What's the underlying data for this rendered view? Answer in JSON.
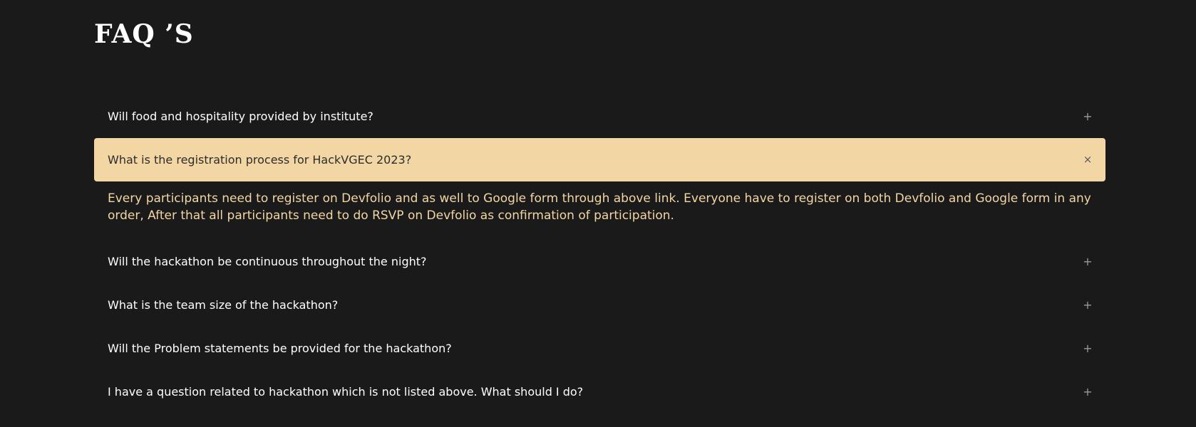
{
  "header": {
    "title": "FAQ ’S"
  },
  "faqs": [
    {
      "question": "Will food and hospitality provided by institute?",
      "toggle": "+",
      "open": false,
      "answer": ""
    },
    {
      "question": "What is the registration process for HackVGEC 2023?",
      "toggle": "×",
      "open": true,
      "answer": "Every participants need to register on Devfolio and as well to Google form through above link. Everyone have to register on both Devfolio and Google form in any order, After that all participants need to do RSVP on Devfolio as confirmation of participation."
    },
    {
      "question": "Will the hackathon be continuous throughout the night?",
      "toggle": "+",
      "open": false,
      "answer": ""
    },
    {
      "question": "What is the team size of the hackathon?",
      "toggle": "+",
      "open": false,
      "answer": ""
    },
    {
      "question": "Will the Problem statements be provided for the hackathon?",
      "toggle": "+",
      "open": false,
      "answer": ""
    },
    {
      "question": "I have a question related to hackathon which is not listed above. What should I do?",
      "toggle": "+",
      "open": false,
      "answer": ""
    }
  ],
  "colors": {
    "background": "#1a1a1a",
    "accent": "#f2d6a4",
    "text": "#ffffff"
  },
  "icons": {
    "collapsed": "plus-icon",
    "expanded": "close-icon"
  }
}
